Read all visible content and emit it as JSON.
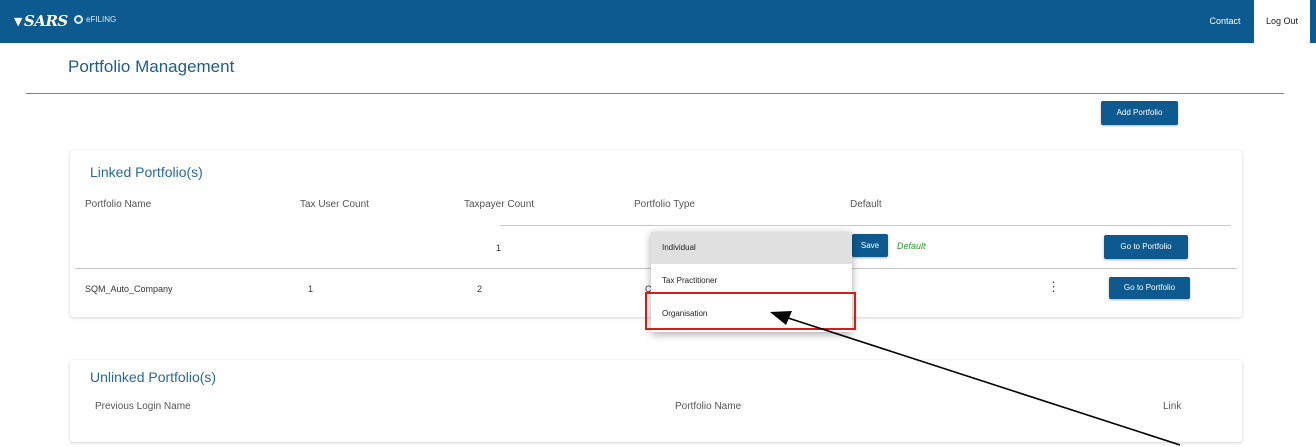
{
  "header": {
    "brand": "SARS",
    "efiling": "eFILING",
    "contact": "Contact",
    "logout": "Log Out"
  },
  "page": {
    "title": "Portfolio Management",
    "add_portfolio": "Add Portfolio"
  },
  "linked": {
    "title": "Linked Portfolio(s)",
    "columns": [
      "Portfolio Name",
      "Tax User Count",
      "Taxpayer Count",
      "Portfolio Type",
      "Default"
    ],
    "rows": [
      {
        "name": "",
        "tax_user_count": "",
        "taxpayer_count": "1",
        "save": "Save",
        "default": "Default",
        "go": "Go to Portfolio"
      },
      {
        "name": "SQM_Auto_Company",
        "tax_user_count": "1",
        "taxpayer_count": "2",
        "type_partial": "C",
        "go": "Go to Portfolio"
      }
    ]
  },
  "dropdown": {
    "options": [
      "Individual",
      "Tax Practitioner",
      "Organisation"
    ],
    "selected": "Individual",
    "highlighted": "Organisation"
  },
  "unlinked": {
    "title": "Unlinked Portfolio(s)",
    "columns": [
      "Previous Login Name",
      "Portfolio Name",
      "Link"
    ]
  },
  "colors": {
    "header": "#0c5a8f",
    "title": "#1e5d8a",
    "default_text": "#2e9b2e",
    "highlight": "#d31d1d"
  }
}
